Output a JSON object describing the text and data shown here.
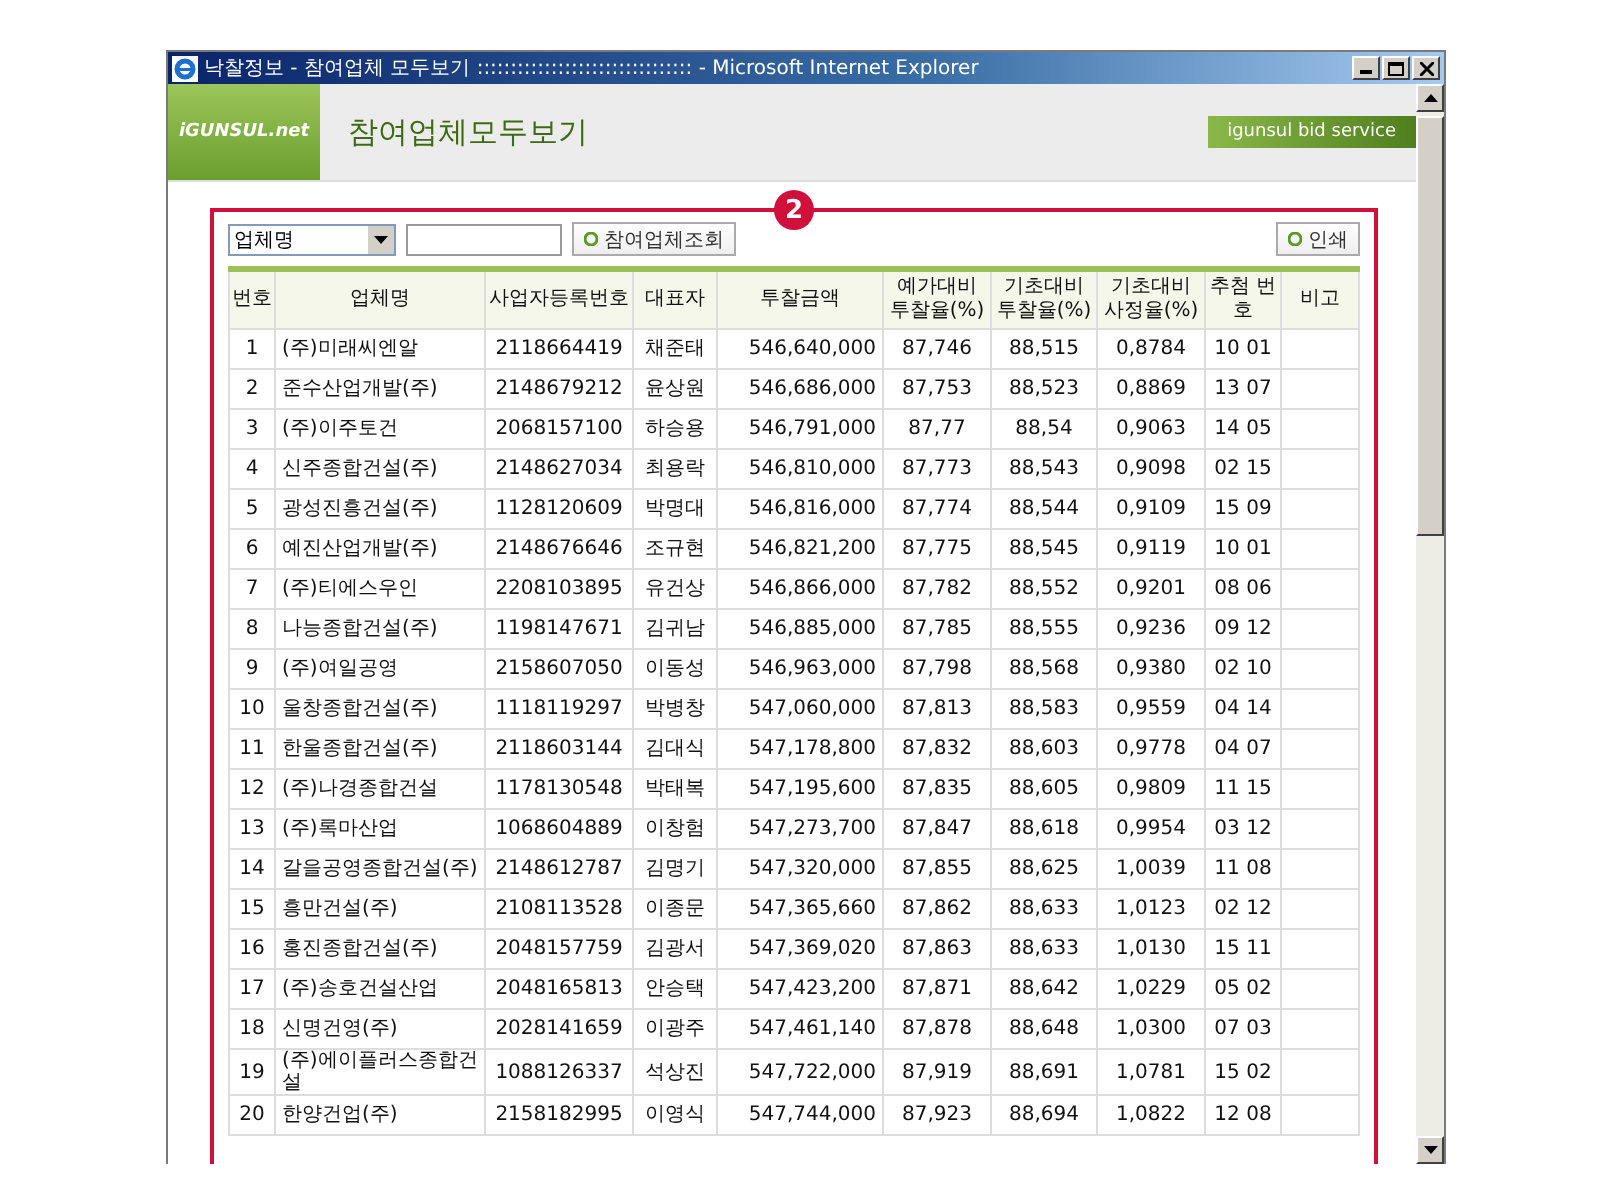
{
  "window": {
    "title": "낙찰정보 - 참여업체 모두보기 :::::::::::::::::::::::::::::::: - Microsoft Internet Explorer"
  },
  "header": {
    "logo": "iGUNSUL.net",
    "page_title": "참여업체모두보기",
    "service_badge": "igunsul bid service"
  },
  "callout": "2",
  "toolbar": {
    "select_value": "업체명",
    "search_button": "참여업체조회",
    "print_button": "인쇄"
  },
  "table": {
    "columns": [
      "번호",
      "업체명",
      "사업자등록번호",
      "대표자",
      "투찰금액",
      "예가대비 투찰율(%)",
      "기초대비 투찰율(%)",
      "기초대비 사정율(%)",
      "추첨 번호",
      "비고"
    ],
    "rows": [
      [
        "1",
        "(주)미래씨엔알",
        "2118664419",
        "채준태",
        "546,640,000",
        "87,746",
        "88,515",
        "0,8784",
        "10 01"
      ],
      [
        "2",
        "준수산업개발(주)",
        "2148679212",
        "윤상원",
        "546,686,000",
        "87,753",
        "88,523",
        "0,8869",
        "13 07"
      ],
      [
        "3",
        "(주)이주토건",
        "2068157100",
        "하승용",
        "546,791,000",
        "87,77",
        "88,54",
        "0,9063",
        "14 05"
      ],
      [
        "4",
        "신주종합건설(주)",
        "2148627034",
        "최용락",
        "546,810,000",
        "87,773",
        "88,543",
        "0,9098",
        "02 15"
      ],
      [
        "5",
        "광성진흥건설(주)",
        "1128120609",
        "박명대",
        "546,816,000",
        "87,774",
        "88,544",
        "0,9109",
        "15 09"
      ],
      [
        "6",
        "예진산업개발(주)",
        "2148676646",
        "조규현",
        "546,821,200",
        "87,775",
        "88,545",
        "0,9119",
        "10 01"
      ],
      [
        "7",
        "(주)티에스우인",
        "2208103895",
        "유건상",
        "546,866,000",
        "87,782",
        "88,552",
        "0,9201",
        "08 06"
      ],
      [
        "8",
        "나능종합건설(주)",
        "1198147671",
        "김귀남",
        "546,885,000",
        "87,785",
        "88,555",
        "0,9236",
        "09 12"
      ],
      [
        "9",
        "(주)여일공영",
        "2158607050",
        "이동성",
        "546,963,000",
        "87,798",
        "88,568",
        "0,9380",
        "02 10"
      ],
      [
        "10",
        "울창종합건설(주)",
        "1118119297",
        "박병창",
        "547,060,000",
        "87,813",
        "88,583",
        "0,9559",
        "04 14"
      ],
      [
        "11",
        "한울종합건설(주)",
        "2118603144",
        "김대식",
        "547,178,800",
        "87,832",
        "88,603",
        "0,9778",
        "04 07"
      ],
      [
        "12",
        "(주)나경종합건설",
        "1178130548",
        "박태복",
        "547,195,600",
        "87,835",
        "88,605",
        "0,9809",
        "11 15"
      ],
      [
        "13",
        "(주)록마산업",
        "1068604889",
        "이창험",
        "547,273,700",
        "87,847",
        "88,618",
        "0,9954",
        "03 12"
      ],
      [
        "14",
        "갈을공영종합건설(주)",
        "2148612787",
        "김명기",
        "547,320,000",
        "87,855",
        "88,625",
        "1,0039",
        "11 08"
      ],
      [
        "15",
        "흥만건설(주)",
        "2108113528",
        "이종문",
        "547,365,660",
        "87,862",
        "88,633",
        "1,0123",
        "02 12"
      ],
      [
        "16",
        "홍진종합건설(주)",
        "2048157759",
        "김광서",
        "547,369,020",
        "87,863",
        "88,633",
        "1,0130",
        "15 11"
      ],
      [
        "17",
        "(주)송호건설산업",
        "2048165813",
        "안승택",
        "547,423,200",
        "87,871",
        "88,642",
        "1,0229",
        "05 02"
      ],
      [
        "18",
        "신명건영(주)",
        "2028141659",
        "이광주",
        "547,461,140",
        "87,878",
        "88,648",
        "1,0300",
        "07 03"
      ],
      [
        "19",
        "(주)에이플러스종합건설",
        "1088126337",
        "석상진",
        "547,722,000",
        "87,919",
        "88,691",
        "1,0781",
        "15 02"
      ],
      [
        "20",
        "한양건업(주)",
        "2158182995",
        "이영식",
        "547,744,000",
        "87,923",
        "88,694",
        "1,0822",
        "12 08"
      ]
    ]
  }
}
